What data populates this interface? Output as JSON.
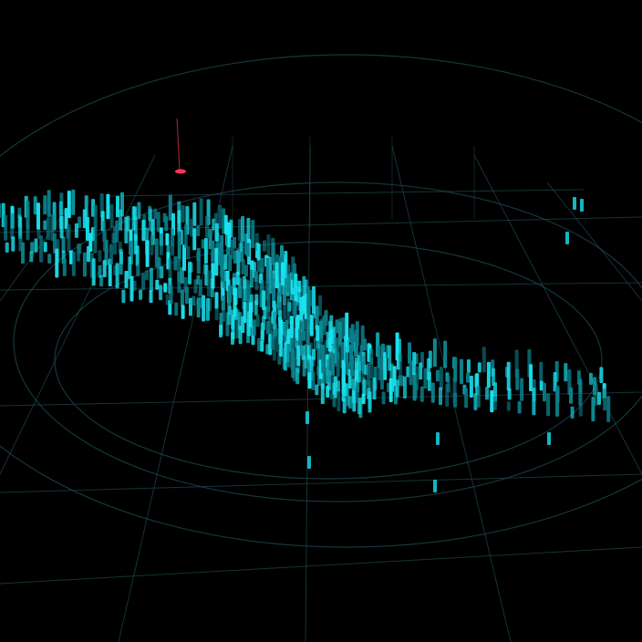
{
  "scene": {
    "view": "lidar-point-cloud-3d",
    "background_color": "#000000",
    "point_color": "#19e3f0",
    "point_color_dim": "#0b7f8a",
    "grid_color": "#1e4a50",
    "ring_color": "#1c4a52",
    "marker_color": "#ff3355",
    "marker_icon": "origin-axis-marker"
  }
}
